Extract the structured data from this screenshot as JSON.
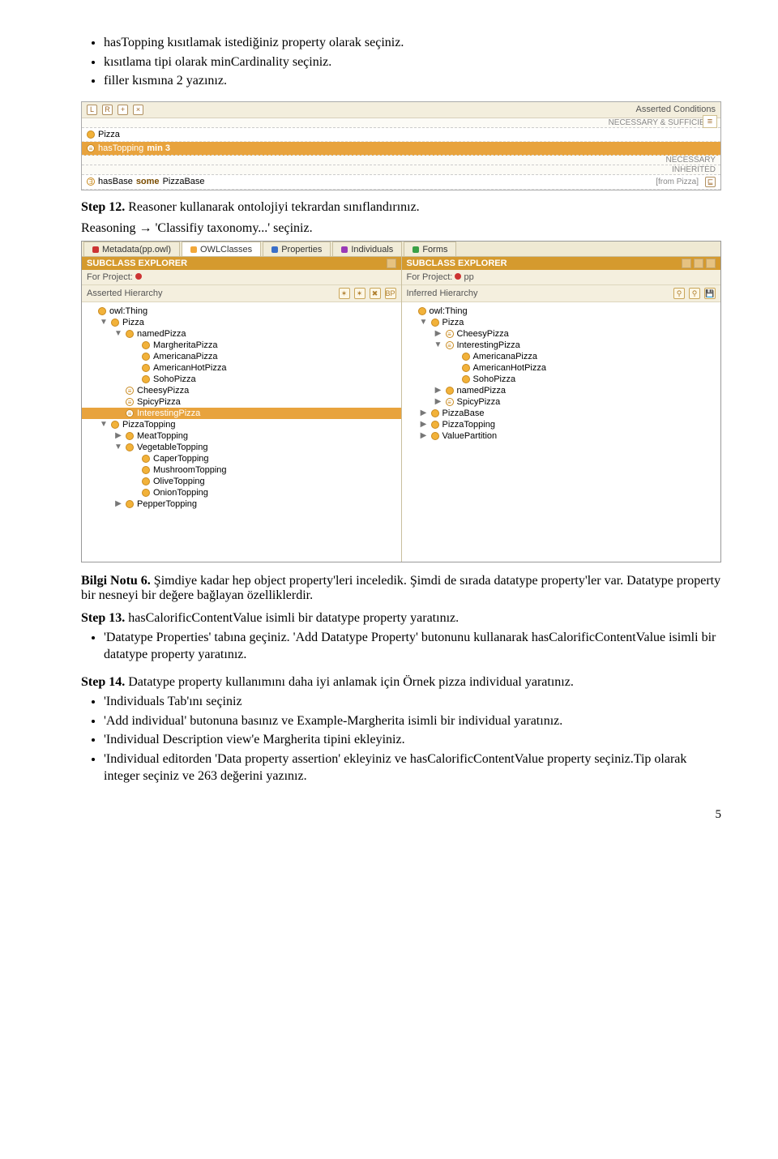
{
  "top_bullets": [
    "hasTopping kısıtlamak istediğiniz property olarak seçiniz.",
    "kısıtlama tipi olarak minCardinality seçiniz.",
    "filler kısmına 2 yazınız."
  ],
  "shot1": {
    "title_right": "Asserted Conditions",
    "section_ns": "NECESSARY & SUFFICIENT",
    "section_n": "NECESSARY",
    "section_inh": "INHERITED",
    "row_pizza": "Pizza",
    "row_hastopping_a": "hasTopping",
    "row_hastopping_b": "min 3",
    "row_hasbase_a": "hasBase",
    "row_hasbase_b": "some",
    "row_hasbase_c": "PizzaBase",
    "row_hasbase_from": "[from Pizza]"
  },
  "step12": {
    "label": "Step 12.",
    "text": " Reasoner kullanarak ontolojiyi tekrardan sınıflandırınız.",
    "line2": "Reasoning → 'Classifiy taxonomy...' seçiniz."
  },
  "shot2": {
    "tabs": [
      "Metadata(pp.owl)",
      "OWLClasses",
      "Properties",
      "Individuals",
      "Forms"
    ],
    "left": {
      "header": "SUBCLASS EXPLORER",
      "forproj": "For Project:",
      "asserted": "Asserted Hierarchy",
      "tree": [
        {
          "ind": 0,
          "toggle": "",
          "icon": "class",
          "label": "owl:Thing"
        },
        {
          "ind": 1,
          "toggle": "▼",
          "icon": "class",
          "label": "Pizza"
        },
        {
          "ind": 2,
          "toggle": "▼",
          "icon": "class",
          "label": "namedPizza"
        },
        {
          "ind": 3,
          "toggle": "",
          "icon": "class",
          "label": "MargheritaPizza"
        },
        {
          "ind": 3,
          "toggle": "",
          "icon": "class",
          "label": "AmericanaPizza"
        },
        {
          "ind": 3,
          "toggle": "",
          "icon": "class",
          "label": "AmericanHotPizza"
        },
        {
          "ind": 3,
          "toggle": "",
          "icon": "class",
          "label": "SohoPizza"
        },
        {
          "ind": 2,
          "toggle": "",
          "icon": "def",
          "label": "CheesyPizza"
        },
        {
          "ind": 2,
          "toggle": "",
          "icon": "def",
          "label": "SpicyPizza"
        },
        {
          "ind": 2,
          "toggle": "",
          "icon": "def",
          "label": "InterestingPizza",
          "sel": true
        },
        {
          "ind": 1,
          "toggle": "▼",
          "icon": "class",
          "label": "PizzaTopping"
        },
        {
          "ind": 2,
          "toggle": "▶",
          "icon": "class",
          "label": "MeatTopping"
        },
        {
          "ind": 2,
          "toggle": "▼",
          "icon": "class",
          "label": "VegetableTopping"
        },
        {
          "ind": 3,
          "toggle": "",
          "icon": "class",
          "label": "CaperTopping"
        },
        {
          "ind": 3,
          "toggle": "",
          "icon": "class",
          "label": "MushroomTopping"
        },
        {
          "ind": 3,
          "toggle": "",
          "icon": "class",
          "label": "OliveTopping"
        },
        {
          "ind": 3,
          "toggle": "",
          "icon": "class",
          "label": "OnionTopping"
        },
        {
          "ind": 2,
          "toggle": "▶",
          "icon": "class",
          "label": "PepperTopping"
        }
      ]
    },
    "right": {
      "header": "SUBCLASS EXPLORER",
      "forproj": "For Project:",
      "projname": "pp",
      "inferred": "Inferred Hierarchy",
      "tree": [
        {
          "ind": 0,
          "toggle": "",
          "icon": "class",
          "label": "owl:Thing"
        },
        {
          "ind": 1,
          "toggle": "▼",
          "icon": "class",
          "label": "Pizza"
        },
        {
          "ind": 2,
          "toggle": "▶",
          "icon": "def",
          "label": "CheesyPizza"
        },
        {
          "ind": 2,
          "toggle": "▼",
          "icon": "def",
          "label": "InterestingPizza"
        },
        {
          "ind": 3,
          "toggle": "",
          "icon": "class",
          "label": "AmericanaPizza"
        },
        {
          "ind": 3,
          "toggle": "",
          "icon": "class",
          "label": "AmericanHotPizza"
        },
        {
          "ind": 3,
          "toggle": "",
          "icon": "class",
          "label": "SohoPizza"
        },
        {
          "ind": 2,
          "toggle": "▶",
          "icon": "class",
          "label": "namedPizza"
        },
        {
          "ind": 2,
          "toggle": "▶",
          "icon": "def",
          "label": "SpicyPizza"
        },
        {
          "ind": 1,
          "toggle": "▶",
          "icon": "class",
          "label": "PizzaBase"
        },
        {
          "ind": 1,
          "toggle": "▶",
          "icon": "class",
          "label": "PizzaTopping"
        },
        {
          "ind": 1,
          "toggle": "▶",
          "icon": "class",
          "label": "ValuePartition"
        }
      ]
    }
  },
  "bilgi6": {
    "label": "Bilgi Notu 6.",
    "text": " Şimdiye kadar hep object property'leri inceledik. Şimdi de sırada datatype property'ler var. Datatype property bir nesneyi bir değere bağlayan özelliklerdir."
  },
  "step13": {
    "label": "Step 13.",
    "text": " hasCalorificContentValue isimli bir datatype property yaratınız.",
    "bullets": [
      "'Datatype Properties' tabına geçiniz. 'Add Datatype Property' butonunu kullanarak hasCalorificContentValue isimli bir datatype property yaratınız."
    ]
  },
  "step14": {
    "label": "Step 14.",
    "text": " Datatype property kullanımını daha iyi anlamak için Örnek pizza individual yaratınız.",
    "bullets": [
      "'Individuals Tab'ını seçiniz",
      "'Add individual' butonuna basınız ve Example-Margherita isimli bir individual yaratınız.",
      "'Individual Description view'e Margherita tipini ekleyiniz.",
      "'Individual editorden 'Data property assertion' ekleyiniz ve hasCalorificContentValue property seçiniz.Tip olarak integer seçiniz ve 263 değerini yazınız."
    ]
  },
  "page_num": "5"
}
